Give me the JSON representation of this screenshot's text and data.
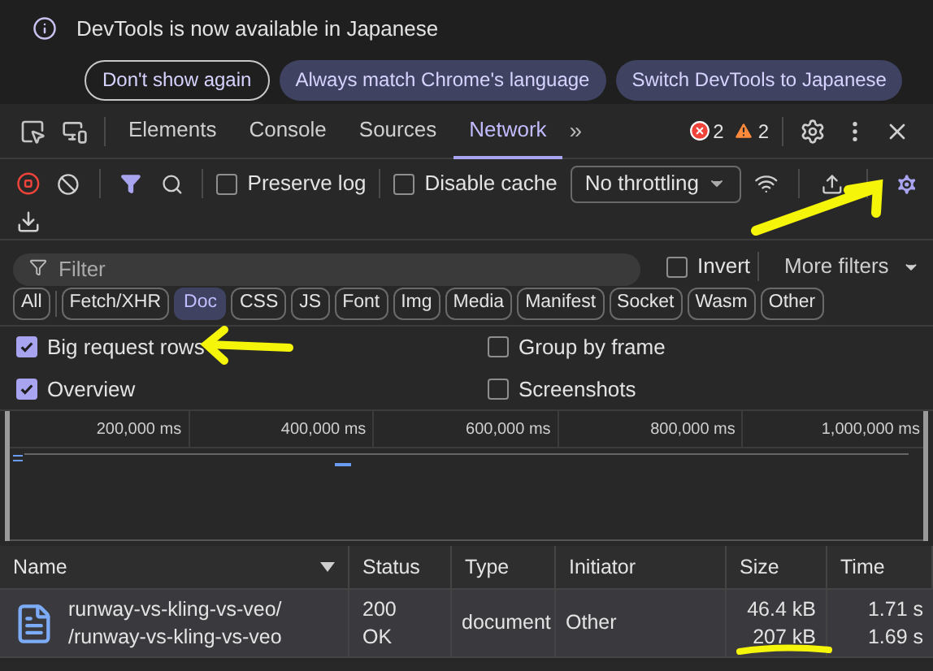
{
  "banner": {
    "message": "DevTools is now available in Japanese",
    "buttons": [
      {
        "label": "Don't show again",
        "kind": "outline"
      },
      {
        "label": "Always match Chrome's language",
        "kind": "filled"
      },
      {
        "label": "Switch DevTools to Japanese",
        "kind": "filled"
      }
    ]
  },
  "tabs": [
    {
      "label": "Elements",
      "selected": false
    },
    {
      "label": "Console",
      "selected": false
    },
    {
      "label": "Sources",
      "selected": false
    },
    {
      "label": "Network",
      "selected": true
    }
  ],
  "more_tabs": "»",
  "errors": "2",
  "warnings": "2",
  "toolbar": {
    "recording": true,
    "preserve_log": {
      "label": "Preserve log",
      "checked": false
    },
    "disable_cache": {
      "label": "Disable cache",
      "checked": false
    },
    "throttling": "No throttling"
  },
  "filter": {
    "placeholder": "Filter",
    "invert": {
      "label": "Invert",
      "checked": false
    },
    "more_filters": "More filters"
  },
  "type_filters": [
    {
      "label": "All",
      "selected": false
    },
    {
      "label": "Fetch/XHR",
      "selected": false
    },
    {
      "label": "Doc",
      "selected": true
    },
    {
      "label": "CSS",
      "selected": false
    },
    {
      "label": "JS",
      "selected": false
    },
    {
      "label": "Font",
      "selected": false
    },
    {
      "label": "Img",
      "selected": false
    },
    {
      "label": "Media",
      "selected": false
    },
    {
      "label": "Manifest",
      "selected": false
    },
    {
      "label": "Socket",
      "selected": false
    },
    {
      "label": "Wasm",
      "selected": false
    },
    {
      "label": "Other",
      "selected": false
    }
  ],
  "options": [
    {
      "label": "Big request rows",
      "checked": true
    },
    {
      "label": "Group by frame",
      "checked": false
    },
    {
      "label": "Overview",
      "checked": true
    },
    {
      "label": "Screenshots",
      "checked": false
    }
  ],
  "overview": {
    "ticks": [
      "200,000 ms",
      "400,000 ms",
      "600,000 ms",
      "800,000 ms",
      "1,000,000 ms"
    ]
  },
  "table": {
    "columns": [
      "Name",
      "Status",
      "Type",
      "Initiator",
      "Size",
      "Time"
    ],
    "rows": [
      {
        "name": "runway-vs-kling-vs-veo/",
        "path": "/runway-vs-kling-vs-veo",
        "status": "200",
        "status_text": "OK",
        "type": "document",
        "initiator": "Other",
        "size": "46.4 kB",
        "resource_size": "207 kB",
        "time": "1.71 s",
        "latency": "1.69 s",
        "selected": true
      }
    ]
  }
}
